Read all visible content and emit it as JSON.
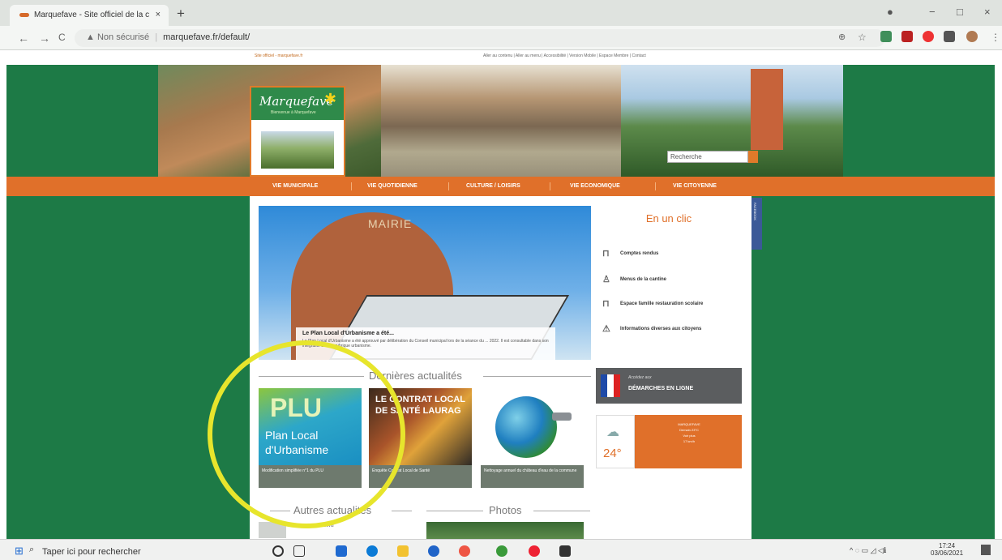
{
  "browser": {
    "tab_title": "Marquefave - Site officiel de la c",
    "tab_close": "×",
    "new_tab": "+",
    "security_label": "Non sécurisé",
    "url": "marquefave.fr/default/",
    "nav": {
      "back": "←",
      "forward": "→",
      "reload": "C"
    }
  },
  "window": {
    "minimize": "−",
    "maximize": "□",
    "close": "×"
  },
  "site": {
    "top_note": "Site officiel - marquefave.fr",
    "top_links": "Aller au contenu | Aller au menu | Accessibilité | Version Mobile | Espace Membre | Contact",
    "logo": {
      "name": "Marquefave",
      "tagline": "Bienvenue à Marquefave"
    },
    "search_placeholder": "Recherche",
    "nav_items": [
      "VIE MUNICIPALE",
      "VIE QUOTIDIENNE",
      "CULTURE / LOISIRS",
      "VIE ECONOMIQUE",
      "VIE CITOYENNE"
    ],
    "hero": {
      "sign": "MAIRIE",
      "caption_title": "Le Plan Local d'Urbanisme a été...",
      "caption_text": "Le Plan Local d'Urbanisme a été approuvé par délibération du Conseil municipal lors de la séance du ... 2022. Il est consultable dans son intégralité dans la rubrique urbanisme."
    },
    "latest_title": "Dernières actualités",
    "cards": [
      {
        "caption": "Modification simplifiée n°1 du PLU",
        "img_text": [
          "PLU",
          "Plan Local",
          "d'Urbanisme"
        ]
      },
      {
        "caption": "Enquête Contrat Local de Santé",
        "img_text": [
          "LE CONTRAT LOCAL",
          "DE SANTÉ LAURAG"
        ]
      },
      {
        "caption": "Nettoyage annuel du château d'eau de la commune",
        "img_text": []
      }
    ],
    "other_news_title": "Autres actualités",
    "photos_title": "Photos",
    "other_news_item": "Point Covid",
    "en_un_clic": {
      "title": "En un clic",
      "items": [
        {
          "label": "Comptes rendus",
          "icon": "mouse-icon"
        },
        {
          "label": "Menus de la cantine",
          "icon": "person-icon"
        },
        {
          "label": "Espace famille restauration scolaire",
          "icon": "mouse-icon"
        },
        {
          "label": "Informations diverses aux citoyens",
          "icon": "warning-icon"
        }
      ]
    },
    "demarches": {
      "small": "Accédez aux",
      "big": "DÉMARCHES EN LIGNE"
    },
    "meteo": {
      "temp": "24°",
      "city": "MARQUEFAVE",
      "details": "Demain 23°C",
      "more": "Voir plus",
      "wind": "17 km/h"
    },
    "facebook": "FACEBOOK"
  },
  "taskbar": {
    "search_placeholder": "Taper ici pour rechercher",
    "time": "17:24",
    "date": "03/06/2021"
  },
  "colors": {
    "green": "#1d7a46",
    "orange": "#e0702a",
    "highlight_circle": "#e7e52c"
  }
}
